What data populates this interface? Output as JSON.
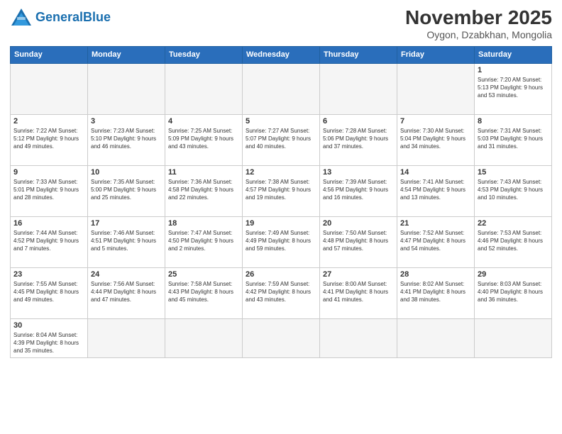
{
  "header": {
    "logo_general": "General",
    "logo_blue": "Blue",
    "month_year": "November 2025",
    "location": "Oygon, Dzabkhan, Mongolia"
  },
  "weekdays": [
    "Sunday",
    "Monday",
    "Tuesday",
    "Wednesday",
    "Thursday",
    "Friday",
    "Saturday"
  ],
  "weeks": [
    [
      {
        "day": "",
        "info": ""
      },
      {
        "day": "",
        "info": ""
      },
      {
        "day": "",
        "info": ""
      },
      {
        "day": "",
        "info": ""
      },
      {
        "day": "",
        "info": ""
      },
      {
        "day": "",
        "info": ""
      },
      {
        "day": "1",
        "info": "Sunrise: 7:20 AM\nSunset: 5:13 PM\nDaylight: 9 hours\nand 53 minutes."
      }
    ],
    [
      {
        "day": "2",
        "info": "Sunrise: 7:22 AM\nSunset: 5:12 PM\nDaylight: 9 hours\nand 49 minutes."
      },
      {
        "day": "3",
        "info": "Sunrise: 7:23 AM\nSunset: 5:10 PM\nDaylight: 9 hours\nand 46 minutes."
      },
      {
        "day": "4",
        "info": "Sunrise: 7:25 AM\nSunset: 5:09 PM\nDaylight: 9 hours\nand 43 minutes."
      },
      {
        "day": "5",
        "info": "Sunrise: 7:27 AM\nSunset: 5:07 PM\nDaylight: 9 hours\nand 40 minutes."
      },
      {
        "day": "6",
        "info": "Sunrise: 7:28 AM\nSunset: 5:06 PM\nDaylight: 9 hours\nand 37 minutes."
      },
      {
        "day": "7",
        "info": "Sunrise: 7:30 AM\nSunset: 5:04 PM\nDaylight: 9 hours\nand 34 minutes."
      },
      {
        "day": "8",
        "info": "Sunrise: 7:31 AM\nSunset: 5:03 PM\nDaylight: 9 hours\nand 31 minutes."
      }
    ],
    [
      {
        "day": "9",
        "info": "Sunrise: 7:33 AM\nSunset: 5:01 PM\nDaylight: 9 hours\nand 28 minutes."
      },
      {
        "day": "10",
        "info": "Sunrise: 7:35 AM\nSunset: 5:00 PM\nDaylight: 9 hours\nand 25 minutes."
      },
      {
        "day": "11",
        "info": "Sunrise: 7:36 AM\nSunset: 4:58 PM\nDaylight: 9 hours\nand 22 minutes."
      },
      {
        "day": "12",
        "info": "Sunrise: 7:38 AM\nSunset: 4:57 PM\nDaylight: 9 hours\nand 19 minutes."
      },
      {
        "day": "13",
        "info": "Sunrise: 7:39 AM\nSunset: 4:56 PM\nDaylight: 9 hours\nand 16 minutes."
      },
      {
        "day": "14",
        "info": "Sunrise: 7:41 AM\nSunset: 4:54 PM\nDaylight: 9 hours\nand 13 minutes."
      },
      {
        "day": "15",
        "info": "Sunrise: 7:43 AM\nSunset: 4:53 PM\nDaylight: 9 hours\nand 10 minutes."
      }
    ],
    [
      {
        "day": "16",
        "info": "Sunrise: 7:44 AM\nSunset: 4:52 PM\nDaylight: 9 hours\nand 7 minutes."
      },
      {
        "day": "17",
        "info": "Sunrise: 7:46 AM\nSunset: 4:51 PM\nDaylight: 9 hours\nand 5 minutes."
      },
      {
        "day": "18",
        "info": "Sunrise: 7:47 AM\nSunset: 4:50 PM\nDaylight: 9 hours\nand 2 minutes."
      },
      {
        "day": "19",
        "info": "Sunrise: 7:49 AM\nSunset: 4:49 PM\nDaylight: 8 hours\nand 59 minutes."
      },
      {
        "day": "20",
        "info": "Sunrise: 7:50 AM\nSunset: 4:48 PM\nDaylight: 8 hours\nand 57 minutes."
      },
      {
        "day": "21",
        "info": "Sunrise: 7:52 AM\nSunset: 4:47 PM\nDaylight: 8 hours\nand 54 minutes."
      },
      {
        "day": "22",
        "info": "Sunrise: 7:53 AM\nSunset: 4:46 PM\nDaylight: 8 hours\nand 52 minutes."
      }
    ],
    [
      {
        "day": "23",
        "info": "Sunrise: 7:55 AM\nSunset: 4:45 PM\nDaylight: 8 hours\nand 49 minutes."
      },
      {
        "day": "24",
        "info": "Sunrise: 7:56 AM\nSunset: 4:44 PM\nDaylight: 8 hours\nand 47 minutes."
      },
      {
        "day": "25",
        "info": "Sunrise: 7:58 AM\nSunset: 4:43 PM\nDaylight: 8 hours\nand 45 minutes."
      },
      {
        "day": "26",
        "info": "Sunrise: 7:59 AM\nSunset: 4:42 PM\nDaylight: 8 hours\nand 43 minutes."
      },
      {
        "day": "27",
        "info": "Sunrise: 8:00 AM\nSunset: 4:41 PM\nDaylight: 8 hours\nand 41 minutes."
      },
      {
        "day": "28",
        "info": "Sunrise: 8:02 AM\nSunset: 4:41 PM\nDaylight: 8 hours\nand 38 minutes."
      },
      {
        "day": "29",
        "info": "Sunrise: 8:03 AM\nSunset: 4:40 PM\nDaylight: 8 hours\nand 36 minutes."
      }
    ],
    [
      {
        "day": "30",
        "info": "Sunrise: 8:04 AM\nSunset: 4:39 PM\nDaylight: 8 hours\nand 35 minutes."
      },
      {
        "day": "",
        "info": ""
      },
      {
        "day": "",
        "info": ""
      },
      {
        "day": "",
        "info": ""
      },
      {
        "day": "",
        "info": ""
      },
      {
        "day": "",
        "info": ""
      },
      {
        "day": "",
        "info": ""
      }
    ]
  ]
}
